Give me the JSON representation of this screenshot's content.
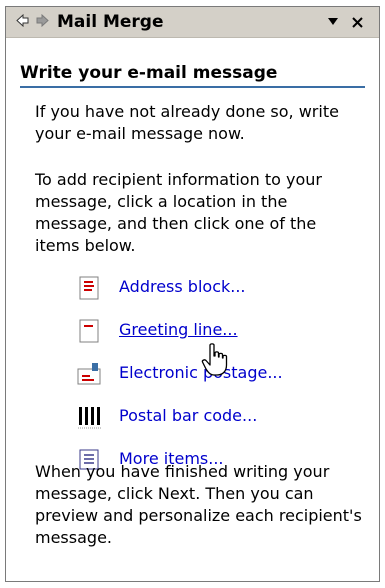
{
  "pane": {
    "title": "Mail Merge",
    "section_title": "Write your e-mail message",
    "intro_text": "If you have not already done so, write your e-mail message now.",
    "instruction_text": "To add recipient information to your message, click a location in the message, and then click one of the items below.",
    "items": [
      {
        "label": "Address block...",
        "icon": "address-block-icon"
      },
      {
        "label": "Greeting line...",
        "icon": "greeting-line-icon"
      },
      {
        "label": "Electronic postage...",
        "icon": "electronic-postage-icon"
      },
      {
        "label": "Postal bar code...",
        "icon": "postal-bar-code-icon"
      },
      {
        "label": "More items...",
        "icon": "more-items-icon"
      }
    ],
    "footer_text": "When you have finished writing your message, click Next. Then you can preview and personalize each recipient's message."
  },
  "colors": {
    "link": "#0000cc",
    "titlebar": "#d4d0c8",
    "rule": "#3a6ea5"
  }
}
